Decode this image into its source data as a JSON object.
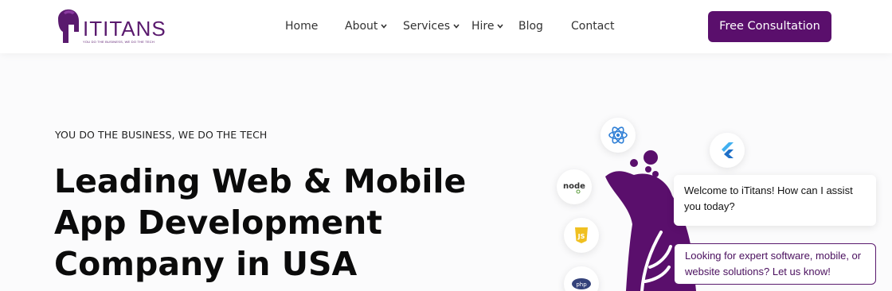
{
  "header": {
    "logo": {
      "wordmark": "ITITANS",
      "tagline": "YOU DO THE BUSINESS, WE DO THE TECH"
    },
    "nav": [
      {
        "label": "Home",
        "has_dropdown": false
      },
      {
        "label": "About",
        "has_dropdown": true
      },
      {
        "label": "Services",
        "has_dropdown": true
      },
      {
        "label": "Hire",
        "has_dropdown": true
      },
      {
        "label": "Blog",
        "has_dropdown": false
      },
      {
        "label": "Contact",
        "has_dropdown": false
      }
    ],
    "cta_label": "Free Consultation"
  },
  "hero": {
    "eyebrow": "YOU DO THE BUSINESS, WE DO THE TECH",
    "headline_lines": [
      "Leading Web & Mobile",
      "App Development",
      "Company in USA"
    ]
  },
  "tech_icons": [
    "react-icon",
    "flutter-icon",
    "node-icon",
    "js-icon",
    "php-icon"
  ],
  "chat": {
    "greeting": "Welcome to iTitans! How can I assist you today?",
    "prompt": "Looking for expert software, mobile, or website solutions? Let us know!"
  },
  "colors": {
    "brand": "#5a0f6c",
    "text": "#0b0b0b",
    "background": "#fbfbfc"
  }
}
